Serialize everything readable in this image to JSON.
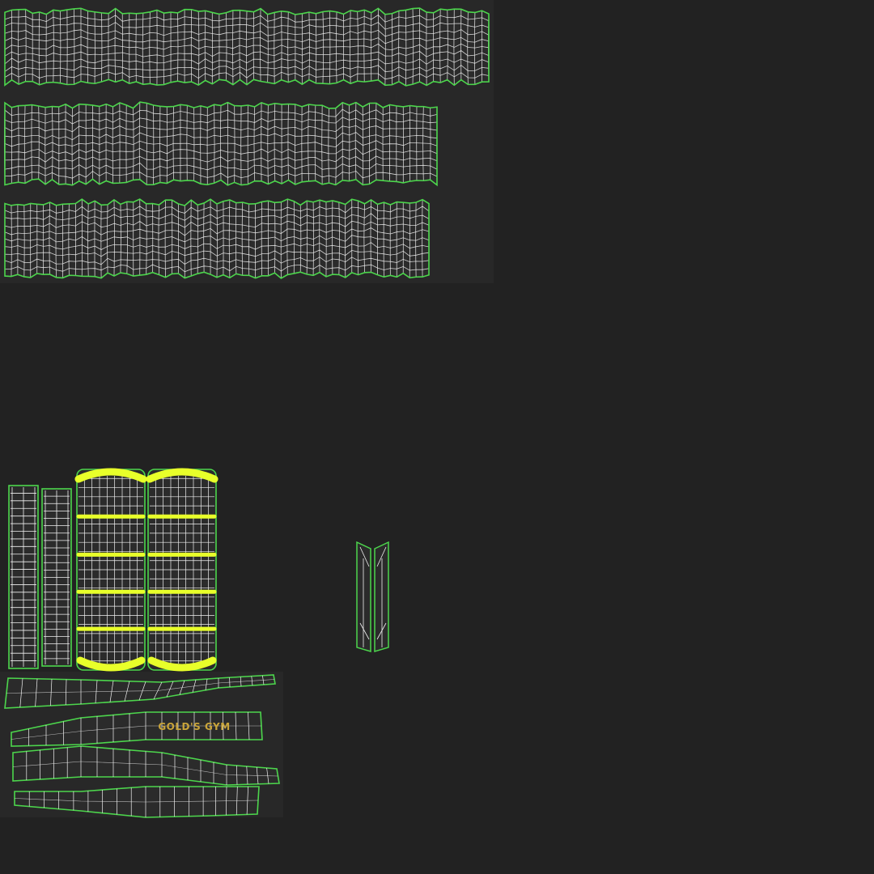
{
  "colors": {
    "background": "#222222",
    "texture_dark": "#2a2a2a",
    "grid_line": "#f2f2f2",
    "seam_green": "#4cd64c",
    "highlight_yellow": "#e8ff2a",
    "logo_gold": "#c9a43a"
  },
  "logo": {
    "text": "GOLD'S GYM"
  }
}
